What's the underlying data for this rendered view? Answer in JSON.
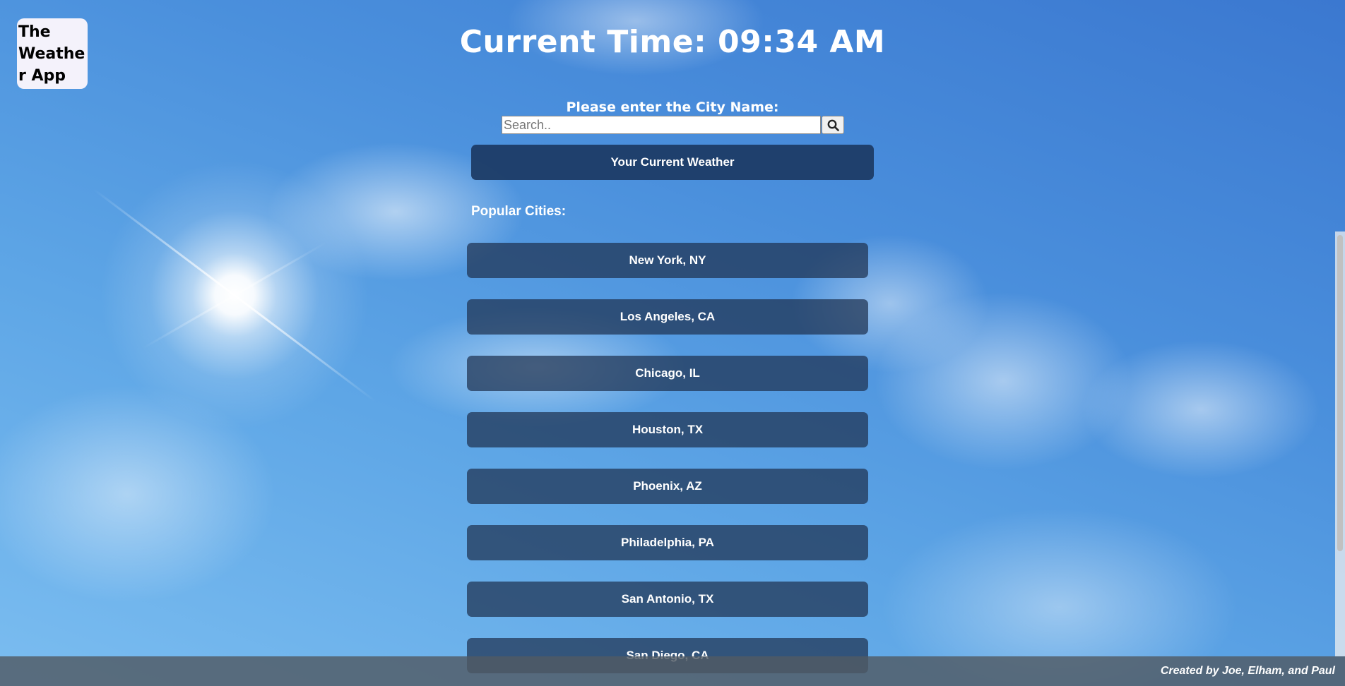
{
  "app": {
    "logo_text": "The Weather App"
  },
  "header": {
    "clock_text": "Current Time: 09:34 AM"
  },
  "search": {
    "prompt": "Please enter the City Name:",
    "placeholder": "Search..",
    "value": "",
    "button_icon": "search-icon"
  },
  "current_weather": {
    "label": "Your Current Weather"
  },
  "popular": {
    "heading": "Popular Cities:",
    "cities": [
      "New York, NY",
      "Los Angeles, CA",
      "Chicago, IL",
      "Houston, TX",
      "Phoenix, AZ",
      "Philadelphia, PA",
      "San Antonio, TX",
      "San Diego, CA"
    ]
  },
  "footer": {
    "credit": "Created by Joe, Elham, and Paul"
  },
  "colors": {
    "button_bg": "#1c3a64",
    "city_button_bg": "#1e3250",
    "footer_bg": "#505a64",
    "text": "#ffffff",
    "logo_bg": "#f4f2fb"
  }
}
